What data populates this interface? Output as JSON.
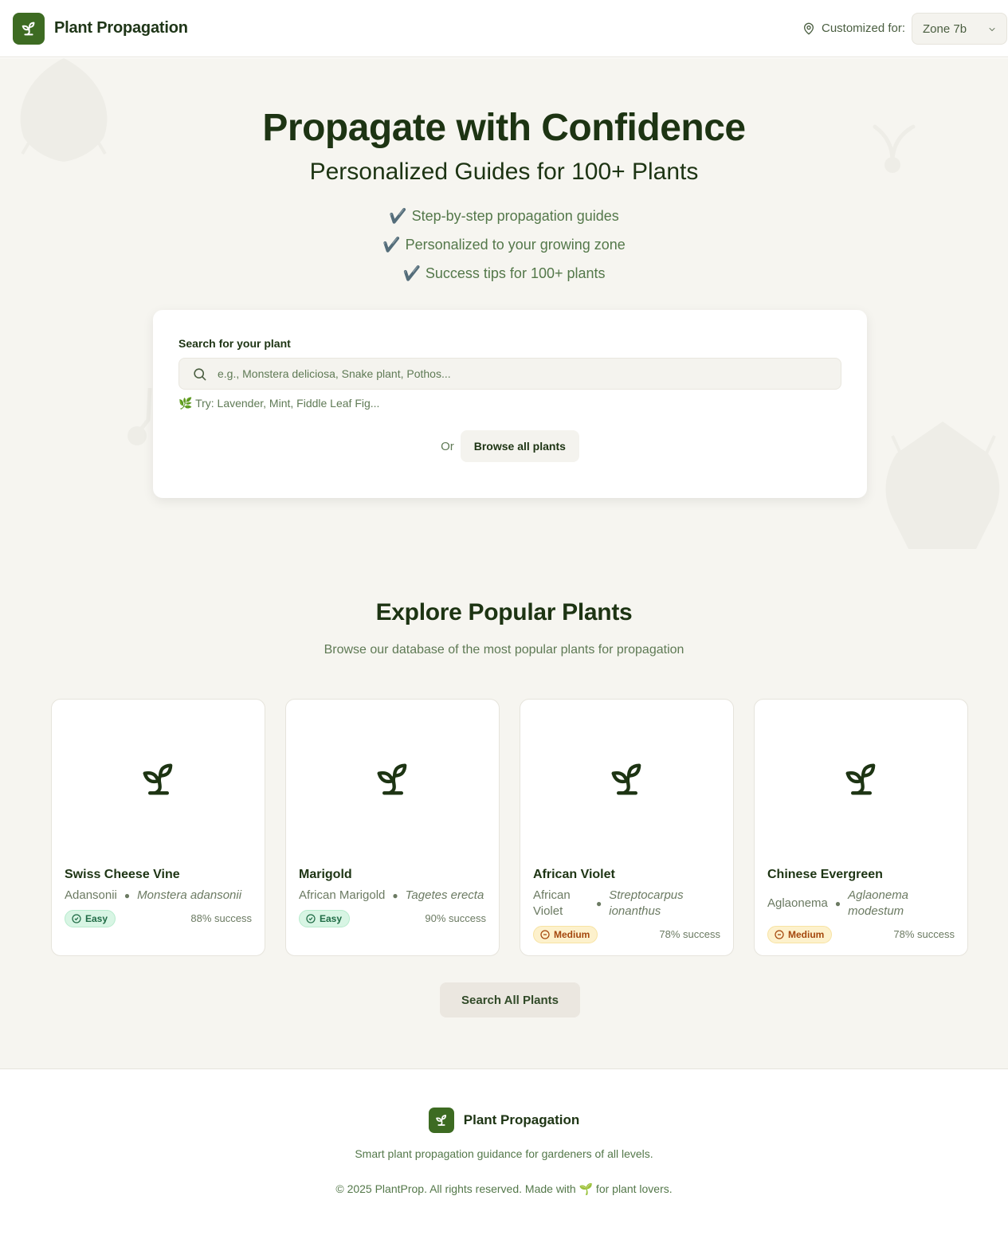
{
  "header": {
    "app_title": "Plant Propagation",
    "customized_label": "Customized for:",
    "zone_value": "Zone 7b",
    "logo_icon": "sprout-icon",
    "pin_icon": "map-pin-icon"
  },
  "hero": {
    "title": "Propagate with Confidence",
    "subtitle": "Personalized Guides for 100+ Plants",
    "bullets": [
      "Step-by-step propagation guides",
      "Personalized to your growing zone",
      "Success tips for 100+ plants"
    ],
    "check_glyph": "✔️"
  },
  "search": {
    "label": "Search for your plant",
    "placeholder": "e.g., Monstera deliciosa, Snake plant, Pothos...",
    "try_text": "🌿 Try: Lavender, Mint, Fiddle Leaf Fig...",
    "or_text": "Or",
    "browse_label": "Browse all plants"
  },
  "explore": {
    "title": "Explore Popular Plants",
    "subtitle": "Browse our database of the most popular plants for propagation",
    "plants": [
      {
        "name": "Swiss Cheese Vine",
        "common": "Adansonii",
        "scientific": "Monstera adansonii",
        "difficulty": "Easy",
        "success": "88% success"
      },
      {
        "name": "Marigold",
        "common": "African Marigold",
        "scientific": "Tagetes erecta",
        "difficulty": "Easy",
        "success": "90% success"
      },
      {
        "name": "African Violet",
        "common": "African Violet",
        "scientific": "Streptocarpus ionanthus",
        "difficulty": "Medium",
        "success": "78% success"
      },
      {
        "name": "Chinese Evergreen",
        "common": "Aglaonema",
        "scientific": "Aglaonema modestum",
        "difficulty": "Medium",
        "success": "78% success"
      }
    ],
    "search_all_label": "Search All Plants"
  },
  "footer": {
    "brand": "Plant Propagation",
    "tagline": "Smart plant propagation guidance for gardeners of all levels.",
    "copyright": "© 2025 PlantProp. All rights reserved. Made with 🌱 for plant lovers."
  },
  "colors": {
    "brand_green": "#3d6b22",
    "heading": "#1d3413",
    "muted_green": "#5f7a55",
    "easy_bg": "#d8f5e4",
    "medium_bg": "#fdf1cc"
  }
}
